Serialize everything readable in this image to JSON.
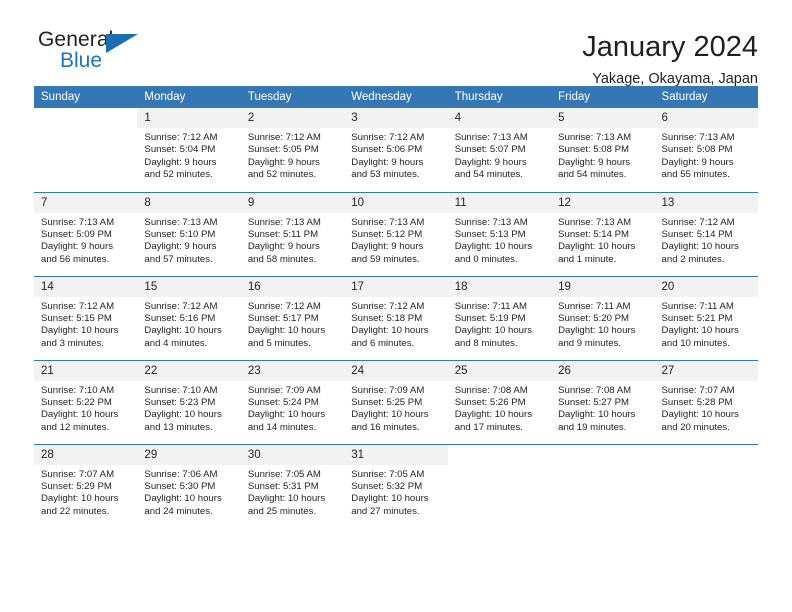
{
  "brand": {
    "name_part1": "General",
    "name_part2": "Blue",
    "triangle_color": "#1c6fb5",
    "blue_color": "#1c75bc"
  },
  "header": {
    "title": "January 2024",
    "location": "Yakage, Okayama, Japan"
  },
  "colors": {
    "header_row_bg": "#3577b5",
    "daynum_bg": "#f2f2f2",
    "text": "#231f20",
    "grid_line": "#3577b5"
  },
  "weekdays": [
    "Sunday",
    "Monday",
    "Tuesday",
    "Wednesday",
    "Thursday",
    "Friday",
    "Saturday"
  ],
  "labels": {
    "sunrise_prefix": "Sunrise: ",
    "sunset_prefix": "Sunset: ",
    "daylight_prefix": "Daylight: "
  },
  "weeks": [
    [
      {
        "day": ""
      },
      {
        "day": "1",
        "sunrise": "Sunrise: 7:12 AM",
        "sunset": "Sunset: 5:04 PM",
        "daylight_line1": "Daylight: 9 hours",
        "daylight_line2": "and 52 minutes."
      },
      {
        "day": "2",
        "sunrise": "Sunrise: 7:12 AM",
        "sunset": "Sunset: 5:05 PM",
        "daylight_line1": "Daylight: 9 hours",
        "daylight_line2": "and 52 minutes."
      },
      {
        "day": "3",
        "sunrise": "Sunrise: 7:12 AM",
        "sunset": "Sunset: 5:06 PM",
        "daylight_line1": "Daylight: 9 hours",
        "daylight_line2": "and 53 minutes."
      },
      {
        "day": "4",
        "sunrise": "Sunrise: 7:13 AM",
        "sunset": "Sunset: 5:07 PM",
        "daylight_line1": "Daylight: 9 hours",
        "daylight_line2": "and 54 minutes."
      },
      {
        "day": "5",
        "sunrise": "Sunrise: 7:13 AM",
        "sunset": "Sunset: 5:08 PM",
        "daylight_line1": "Daylight: 9 hours",
        "daylight_line2": "and 54 minutes."
      },
      {
        "day": "6",
        "sunrise": "Sunrise: 7:13 AM",
        "sunset": "Sunset: 5:08 PM",
        "daylight_line1": "Daylight: 9 hours",
        "daylight_line2": "and 55 minutes."
      }
    ],
    [
      {
        "day": "7",
        "sunrise": "Sunrise: 7:13 AM",
        "sunset": "Sunset: 5:09 PM",
        "daylight_line1": "Daylight: 9 hours",
        "daylight_line2": "and 56 minutes."
      },
      {
        "day": "8",
        "sunrise": "Sunrise: 7:13 AM",
        "sunset": "Sunset: 5:10 PM",
        "daylight_line1": "Daylight: 9 hours",
        "daylight_line2": "and 57 minutes."
      },
      {
        "day": "9",
        "sunrise": "Sunrise: 7:13 AM",
        "sunset": "Sunset: 5:11 PM",
        "daylight_line1": "Daylight: 9 hours",
        "daylight_line2": "and 58 minutes."
      },
      {
        "day": "10",
        "sunrise": "Sunrise: 7:13 AM",
        "sunset": "Sunset: 5:12 PM",
        "daylight_line1": "Daylight: 9 hours",
        "daylight_line2": "and 59 minutes."
      },
      {
        "day": "11",
        "sunrise": "Sunrise: 7:13 AM",
        "sunset": "Sunset: 5:13 PM",
        "daylight_line1": "Daylight: 10 hours",
        "daylight_line2": "and 0 minutes."
      },
      {
        "day": "12",
        "sunrise": "Sunrise: 7:13 AM",
        "sunset": "Sunset: 5:14 PM",
        "daylight_line1": "Daylight: 10 hours",
        "daylight_line2": "and 1 minute."
      },
      {
        "day": "13",
        "sunrise": "Sunrise: 7:12 AM",
        "sunset": "Sunset: 5:14 PM",
        "daylight_line1": "Daylight: 10 hours",
        "daylight_line2": "and 2 minutes."
      }
    ],
    [
      {
        "day": "14",
        "sunrise": "Sunrise: 7:12 AM",
        "sunset": "Sunset: 5:15 PM",
        "daylight_line1": "Daylight: 10 hours",
        "daylight_line2": "and 3 minutes."
      },
      {
        "day": "15",
        "sunrise": "Sunrise: 7:12 AM",
        "sunset": "Sunset: 5:16 PM",
        "daylight_line1": "Daylight: 10 hours",
        "daylight_line2": "and 4 minutes."
      },
      {
        "day": "16",
        "sunrise": "Sunrise: 7:12 AM",
        "sunset": "Sunset: 5:17 PM",
        "daylight_line1": "Daylight: 10 hours",
        "daylight_line2": "and 5 minutes."
      },
      {
        "day": "17",
        "sunrise": "Sunrise: 7:12 AM",
        "sunset": "Sunset: 5:18 PM",
        "daylight_line1": "Daylight: 10 hours",
        "daylight_line2": "and 6 minutes."
      },
      {
        "day": "18",
        "sunrise": "Sunrise: 7:11 AM",
        "sunset": "Sunset: 5:19 PM",
        "daylight_line1": "Daylight: 10 hours",
        "daylight_line2": "and 8 minutes."
      },
      {
        "day": "19",
        "sunrise": "Sunrise: 7:11 AM",
        "sunset": "Sunset: 5:20 PM",
        "daylight_line1": "Daylight: 10 hours",
        "daylight_line2": "and 9 minutes."
      },
      {
        "day": "20",
        "sunrise": "Sunrise: 7:11 AM",
        "sunset": "Sunset: 5:21 PM",
        "daylight_line1": "Daylight: 10 hours",
        "daylight_line2": "and 10 minutes."
      }
    ],
    [
      {
        "day": "21",
        "sunrise": "Sunrise: 7:10 AM",
        "sunset": "Sunset: 5:22 PM",
        "daylight_line1": "Daylight: 10 hours",
        "daylight_line2": "and 12 minutes."
      },
      {
        "day": "22",
        "sunrise": "Sunrise: 7:10 AM",
        "sunset": "Sunset: 5:23 PM",
        "daylight_line1": "Daylight: 10 hours",
        "daylight_line2": "and 13 minutes."
      },
      {
        "day": "23",
        "sunrise": "Sunrise: 7:09 AM",
        "sunset": "Sunset: 5:24 PM",
        "daylight_line1": "Daylight: 10 hours",
        "daylight_line2": "and 14 minutes."
      },
      {
        "day": "24",
        "sunrise": "Sunrise: 7:09 AM",
        "sunset": "Sunset: 5:25 PM",
        "daylight_line1": "Daylight: 10 hours",
        "daylight_line2": "and 16 minutes."
      },
      {
        "day": "25",
        "sunrise": "Sunrise: 7:08 AM",
        "sunset": "Sunset: 5:26 PM",
        "daylight_line1": "Daylight: 10 hours",
        "daylight_line2": "and 17 minutes."
      },
      {
        "day": "26",
        "sunrise": "Sunrise: 7:08 AM",
        "sunset": "Sunset: 5:27 PM",
        "daylight_line1": "Daylight: 10 hours",
        "daylight_line2": "and 19 minutes."
      },
      {
        "day": "27",
        "sunrise": "Sunrise: 7:07 AM",
        "sunset": "Sunset: 5:28 PM",
        "daylight_line1": "Daylight: 10 hours",
        "daylight_line2": "and 20 minutes."
      }
    ],
    [
      {
        "day": "28",
        "sunrise": "Sunrise: 7:07 AM",
        "sunset": "Sunset: 5:29 PM",
        "daylight_line1": "Daylight: 10 hours",
        "daylight_line2": "and 22 minutes."
      },
      {
        "day": "29",
        "sunrise": "Sunrise: 7:06 AM",
        "sunset": "Sunset: 5:30 PM",
        "daylight_line1": "Daylight: 10 hours",
        "daylight_line2": "and 24 minutes."
      },
      {
        "day": "30",
        "sunrise": "Sunrise: 7:05 AM",
        "sunset": "Sunset: 5:31 PM",
        "daylight_line1": "Daylight: 10 hours",
        "daylight_line2": "and 25 minutes."
      },
      {
        "day": "31",
        "sunrise": "Sunrise: 7:05 AM",
        "sunset": "Sunset: 5:32 PM",
        "daylight_line1": "Daylight: 10 hours",
        "daylight_line2": "and 27 minutes."
      },
      {
        "day": ""
      },
      {
        "day": ""
      },
      {
        "day": ""
      }
    ]
  ]
}
